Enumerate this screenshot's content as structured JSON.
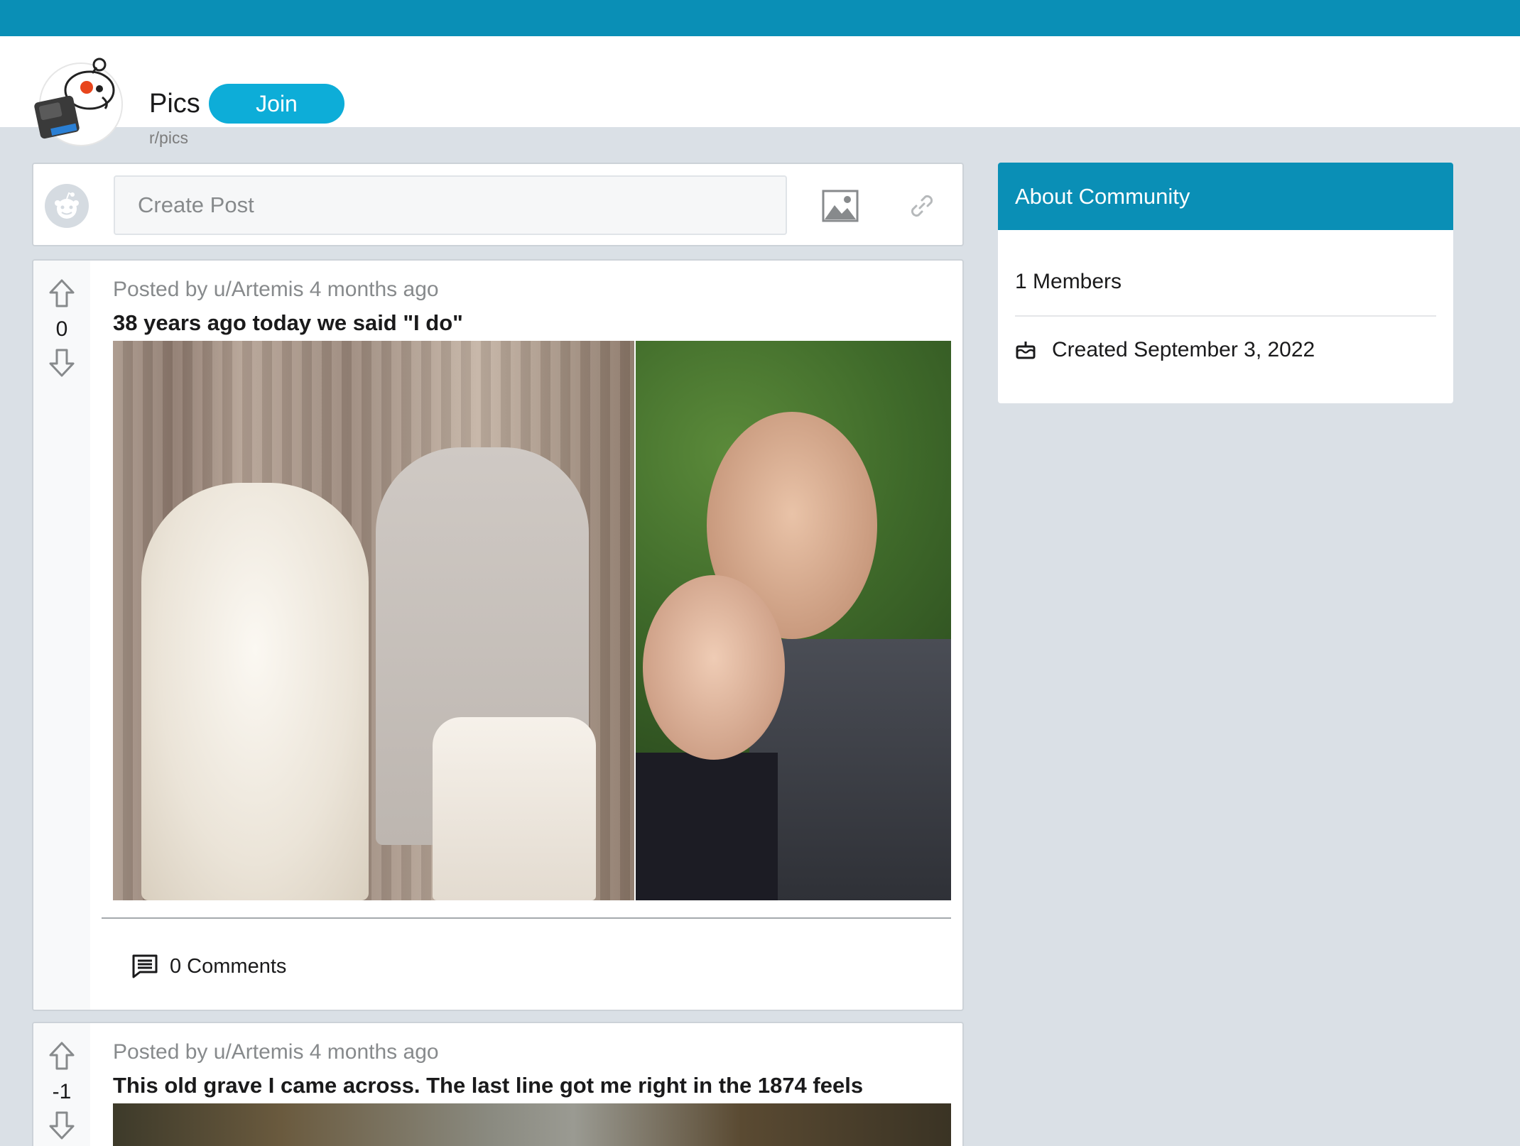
{
  "header": {
    "community_name": "Pics",
    "community_slug": "r/pics",
    "join_label": "Join",
    "icon": "reddit-snoo-camera-icon"
  },
  "create_post": {
    "placeholder": "Create Post",
    "avatar_icon": "reddit-avatar-icon",
    "image_icon": "image-icon",
    "link_icon": "link-icon"
  },
  "posts": [
    {
      "meta": "Posted by u/Artemis 4 months ago",
      "title": "38 years ago today we said \"I do\"",
      "votes": "0",
      "comments_label": "0 Comments"
    },
    {
      "meta": "Posted by u/Artemis 4 months ago",
      "title": "This old grave I came across. The last line got me right in the 1874 feels",
      "votes": "-1"
    }
  ],
  "about": {
    "title": "About Community",
    "members": "1 Members",
    "created": "Created September 3, 2022",
    "created_icon": "cake-icon"
  },
  "colors": {
    "topbar": "#0a8fb6",
    "join_button": "#0dadd8",
    "background": "#dae0e6"
  }
}
